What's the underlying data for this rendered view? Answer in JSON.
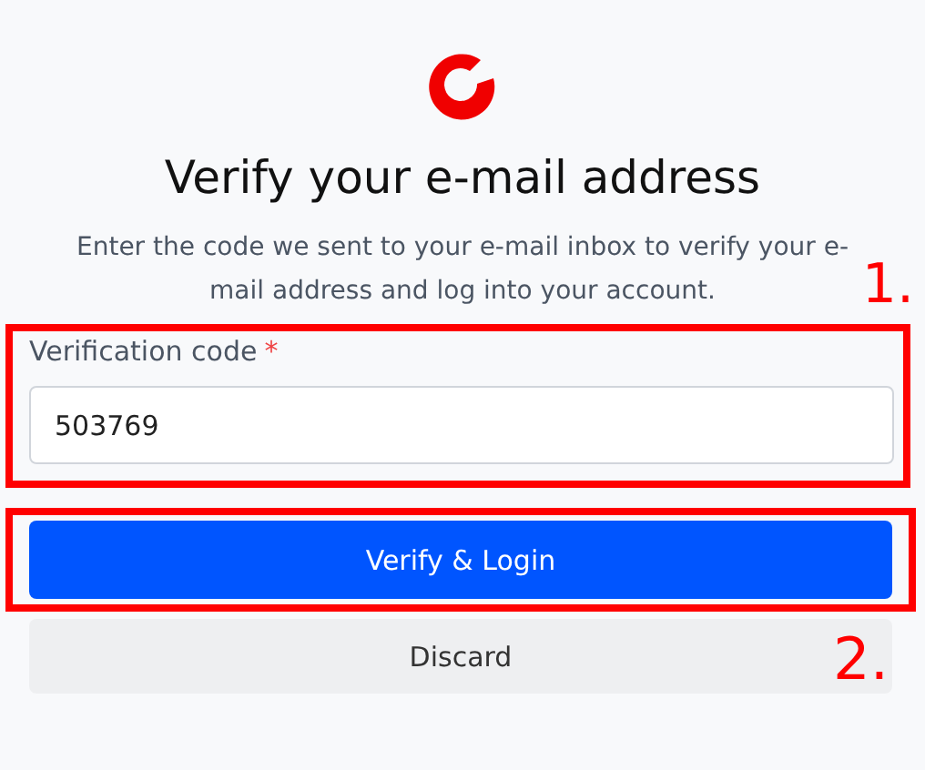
{
  "logo": {
    "kind": "ring"
  },
  "title": "Verify your e-mail address",
  "description": "Enter the code we sent to your e-mail inbox to verify your e-mail address and log into your account.",
  "form": {
    "label": "Verification code",
    "required_mark": "*",
    "value": "503769"
  },
  "buttons": [
    {
      "label": "Verify & Login",
      "kind": "primary"
    },
    {
      "label": "Discard",
      "kind": "secondary"
    }
  ],
  "annotations": [
    "1.",
    "2."
  ]
}
